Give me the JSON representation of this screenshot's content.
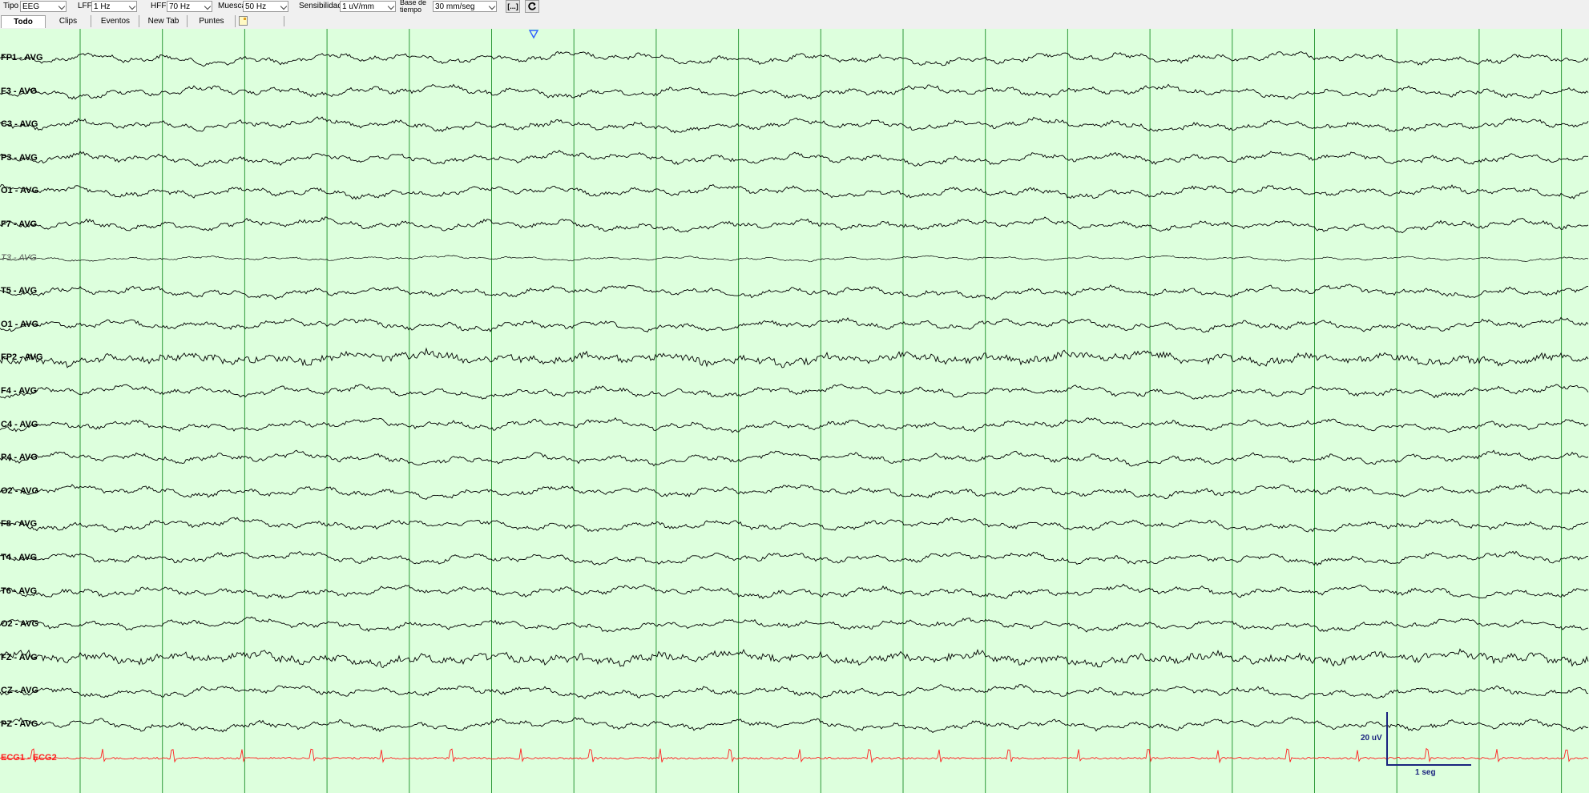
{
  "toolbar": {
    "tipo_label": "Tipo",
    "tipo_value": "EEG",
    "lff_label": "LFF",
    "lff_value": "1 Hz",
    "hff_label": "HFF",
    "hff_value": "70 Hz",
    "muesca_label": "Muesca",
    "muesca_value": "50 Hz",
    "sensibilidad_label": "Sensibilidad",
    "sensibilidad_value": "1 uV/mm",
    "base_label_1": "Base de",
    "base_label_2": "tiempo",
    "base_value": "30 mm/seg",
    "btn_range": "[...]",
    "btn_refresh_icon": "refresh-icon"
  },
  "tabs": [
    {
      "label": "Todo",
      "active": true
    },
    {
      "label": "Clips",
      "active": false
    },
    {
      "label": "Eventos",
      "active": false
    },
    {
      "label": "New Tab",
      "active": false
    },
    {
      "label": "Puntes",
      "active": false
    }
  ],
  "note_icon": "note-icon",
  "channels": [
    {
      "label": "FP1 - AVG"
    },
    {
      "label": "F3 - AVG"
    },
    {
      "label": "C3 - AVG"
    },
    {
      "label": "P3 - AVG"
    },
    {
      "label": "O1 - AVG"
    },
    {
      "label": "F7 - AVG"
    },
    {
      "label": "T3 - AVG",
      "faded": true
    },
    {
      "label": "T5 - AVG"
    },
    {
      "label": "O1 - AVG"
    },
    {
      "label": "FP2 - AVG"
    },
    {
      "label": "F4 - AVG"
    },
    {
      "label": "C4 - AVG"
    },
    {
      "label": "P4 - AVG"
    },
    {
      "label": "O2 - AVG"
    },
    {
      "label": "F8 - AVG"
    },
    {
      "label": "T4 - AVG"
    },
    {
      "label": "T6 - AVG"
    },
    {
      "label": "O2 - AVG"
    },
    {
      "label": "FZ - AVG"
    },
    {
      "label": "CZ - AVG"
    },
    {
      "label": "PZ - AVG"
    },
    {
      "label": "ECG1 - ECG2",
      "ecg": true
    }
  ],
  "calibration": {
    "amplitude_label": "20 uV",
    "time_label": "1 seg"
  },
  "colors": {
    "background": "#ddffdd",
    "grid_line": "#2e9a3a",
    "trace": "#000000",
    "ecg_trace": "#ff2020",
    "calibration": "#1a237e",
    "marker": "#3060ff"
  },
  "marker_icon": "event-marker-icon"
}
